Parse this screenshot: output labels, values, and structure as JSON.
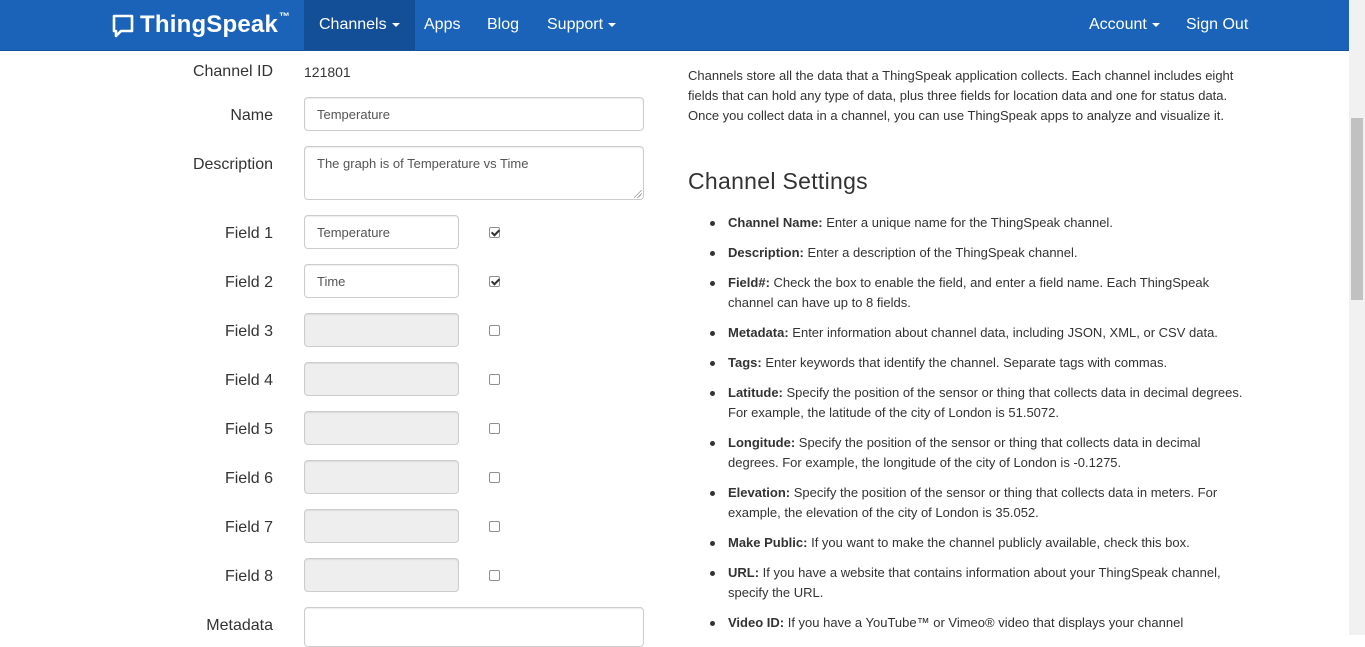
{
  "nav": {
    "brand": "ThingSpeak",
    "brand_tm": "™",
    "items": {
      "channels": "Channels",
      "apps": "Apps",
      "blog": "Blog",
      "support": "Support",
      "account": "Account",
      "signout": "Sign Out"
    }
  },
  "form": {
    "channel_id_label": "Channel ID",
    "channel_id_value": "121801",
    "name_label": "Name",
    "name_value": "Temperature",
    "description_label": "Description",
    "description_value": "The graph is of Temperature vs Time",
    "metadata_label": "Metadata",
    "fields": [
      {
        "label": "Field 1",
        "value": "Temperature",
        "enabled": true
      },
      {
        "label": "Field 2",
        "value": "Time",
        "enabled": true
      },
      {
        "label": "Field 3",
        "value": "",
        "enabled": false
      },
      {
        "label": "Field 4",
        "value": "",
        "enabled": false
      },
      {
        "label": "Field 5",
        "value": "",
        "enabled": false
      },
      {
        "label": "Field 6",
        "value": "",
        "enabled": false
      },
      {
        "label": "Field 7",
        "value": "",
        "enabled": false
      },
      {
        "label": "Field 8",
        "value": "",
        "enabled": false
      }
    ]
  },
  "help": {
    "intro": "Channels store all the data that a ThingSpeak application collects. Each channel includes eight fields that can hold any type of data, plus three fields for location data and one for status data. Once you collect data in a channel, you can use ThingSpeak apps to analyze and visualize it.",
    "title": "Channel Settings",
    "items": [
      {
        "term": "Channel Name:",
        "text": " Enter a unique name for the ThingSpeak channel."
      },
      {
        "term": "Description:",
        "text": " Enter a description of the ThingSpeak channel."
      },
      {
        "term": "Field#:",
        "text": " Check the box to enable the field, and enter a field name. Each ThingSpeak channel can have up to 8 fields."
      },
      {
        "term": "Metadata:",
        "text": " Enter information about channel data, including JSON, XML, or CSV data."
      },
      {
        "term": "Tags:",
        "text": " Enter keywords that identify the channel. Separate tags with commas."
      },
      {
        "term": "Latitude:",
        "text": " Specify the position of the sensor or thing that collects data in decimal degrees. For example, the latitude of the city of London is 51.5072."
      },
      {
        "term": "Longitude:",
        "text": " Specify the position of the sensor or thing that collects data in decimal degrees. For example, the longitude of the city of London is -0.1275."
      },
      {
        "term": "Elevation:",
        "text": " Specify the position of the sensor or thing that collects data in meters. For example, the elevation of the city of London is 35.052."
      },
      {
        "term": "Make Public:",
        "text": " If you want to make the channel publicly available, check this box."
      },
      {
        "term": "URL:",
        "text": " If you have a website that contains information about your ThingSpeak channel, specify the URL."
      },
      {
        "term": "Video ID:",
        "text": " If you have a YouTube™ or Vimeo® video that displays your channel"
      }
    ]
  }
}
